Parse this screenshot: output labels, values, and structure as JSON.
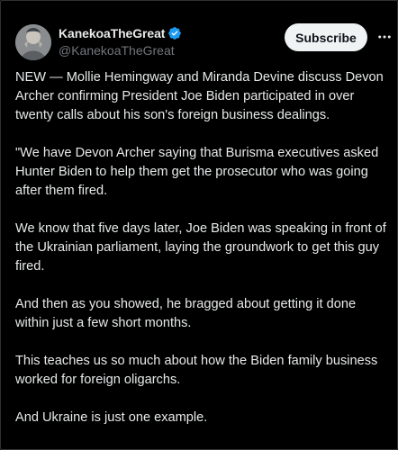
{
  "author": {
    "display_name": "KanekoaTheGreat",
    "handle": "@KanekoaTheGreat",
    "verified": true,
    "verified_icon": "verified-badge-icon",
    "avatar_icon": "avatar"
  },
  "actions": {
    "subscribe_label": "Subscribe",
    "more_icon": "more-icon"
  },
  "tweet": {
    "paragraphs": [
      "NEW — Mollie Hemingway and Miranda Devine discuss Devon Archer confirming President Joe Biden participated in over twenty calls about his son's foreign business dealings.",
      "\"We have Devon Archer saying that Burisma executives asked Hunter Biden to help them get the prosecutor who was going after them fired.",
      "We know that five days later, Joe Biden was speaking in front of the Ukrainian parliament, laying the groundwork to get this guy fired.",
      "And then as you showed, he bragged about getting it done within just a few short months.",
      "This teaches us so much about how the Biden family business worked for foreign oligarchs.",
      "And Ukraine is just one example."
    ]
  },
  "colors": {
    "background": "#000000",
    "text": "#e7e9ea",
    "secondary_text": "#71767b",
    "verified_blue": "#1d9bf0",
    "button_bg": "#eff3f4",
    "button_text": "#0f1419"
  }
}
